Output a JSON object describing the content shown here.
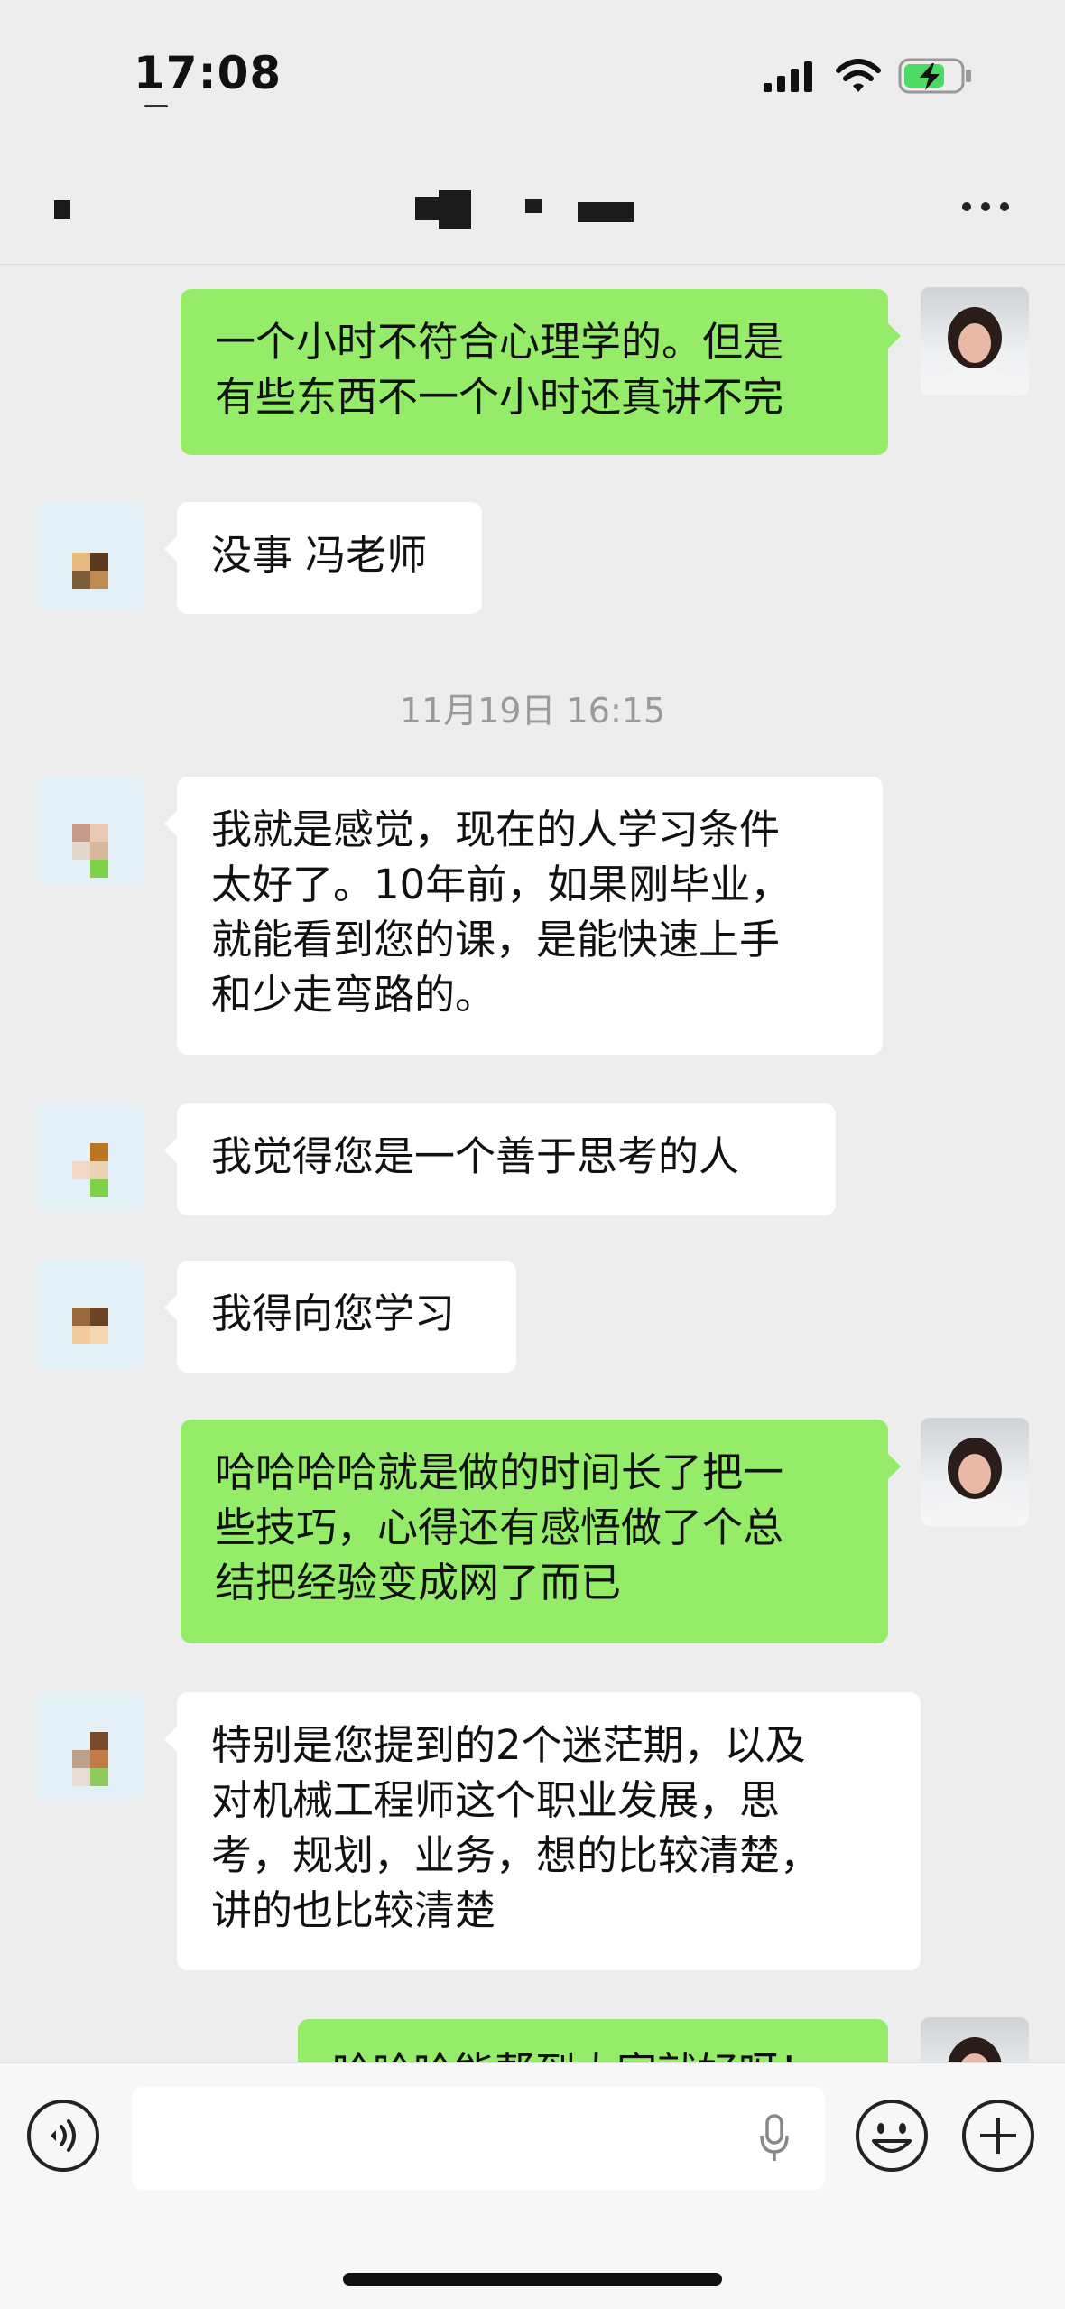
{
  "status_bar": {
    "time": "17:08",
    "battery_color": "#4cd964"
  },
  "nav": {
    "title_obscured": true
  },
  "chat": {
    "messages": [
      {
        "side": "right",
        "text": "一个小时不符合心理学的。但是\n有些东西不一个小时还真讲不完"
      },
      {
        "side": "left",
        "text": "没事 冯老师"
      },
      {
        "type": "timestamp",
        "text": "11月19日 16:15"
      },
      {
        "side": "left",
        "text": "我就是感觉，现在的人学习条件\n太好了。10年前，如果刚毕业，\n就能看到您的课，是能快速上手\n和少走弯路的。"
      },
      {
        "side": "left",
        "text": "我觉得您是一个善于思考的人"
      },
      {
        "side": "left",
        "text": "我得向您学习"
      },
      {
        "side": "right",
        "text": "哈哈哈哈就是做的时间长了把一\n些技巧，心得还有感悟做了个总\n结把经验变成网了而已"
      },
      {
        "side": "left",
        "text": "特别是您提到的2个迷茫期，以及\n对机械工程师这个职业发展，思\n考，规划，业务，想的比较清楚，\n讲的也比较清楚"
      },
      {
        "side": "right",
        "text": "哈哈哈能帮到大家就好呀！"
      }
    ]
  },
  "colors": {
    "my_bubble": "#95ec69",
    "their_bubble": "#ffffff",
    "background": "#ededed"
  },
  "icons": {
    "voice": "voice-icon",
    "mic": "mic-icon",
    "emoji": "emoji-icon",
    "plus": "plus-icon",
    "more": "more-icon"
  }
}
